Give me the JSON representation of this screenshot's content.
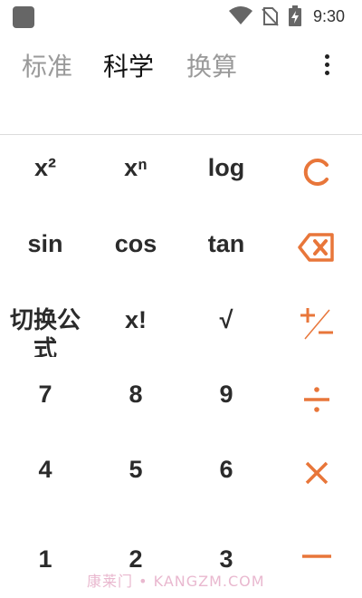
{
  "status_bar": {
    "time": "9:30",
    "icons": [
      "app-icon",
      "wifi-icon",
      "no-sim-icon",
      "battery-charging-icon"
    ]
  },
  "tabs": [
    {
      "label": "标准",
      "active": false
    },
    {
      "label": "科学",
      "active": true
    },
    {
      "label": "换算",
      "active": false
    }
  ],
  "menu_icon": "more-vert-icon",
  "accent_color": "#e8763a",
  "keys": {
    "row1": [
      "x²",
      "xⁿ",
      "log"
    ],
    "row2": [
      "sin",
      "cos",
      "tan"
    ],
    "row3": [
      "切换公式",
      "x!",
      "√"
    ],
    "row4": [
      "7",
      "8",
      "9"
    ],
    "row5": [
      "4",
      "5",
      "6"
    ],
    "row6": [
      "1",
      "2",
      "3"
    ]
  },
  "operators": [
    "clear-icon",
    "backspace-icon",
    "plus-minus-icon",
    "divide-icon",
    "multiply-icon",
    "minus-icon"
  ],
  "watermark": "康莱门 • KANGZM.COM"
}
